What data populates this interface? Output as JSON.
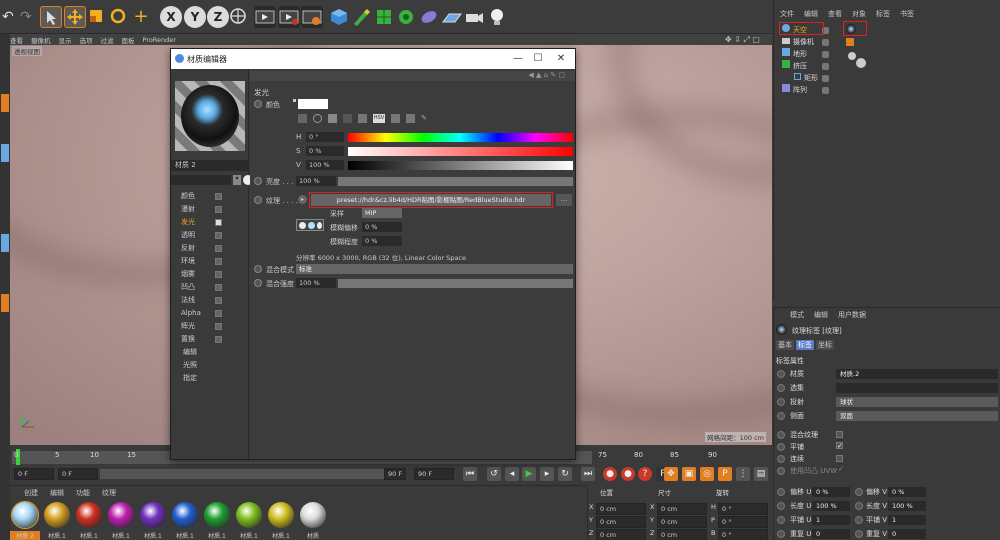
{
  "toolbar": {
    "axis_x": "X",
    "axis_y": "Y",
    "axis_z": "Z"
  },
  "viewport": {
    "menu": [
      "查看",
      "摄像机",
      "显示",
      "选项",
      "过滤",
      "面板",
      "ProRender"
    ],
    "label": "透视视图",
    "grid_spacing": "网格间距：100 cm"
  },
  "timeline": {
    "ticks": [
      "0",
      "5",
      "10",
      "15",
      "75",
      "80",
      "85",
      "90"
    ],
    "start_frame": "0 F",
    "current_frame": "0 F",
    "end_frame": "90 F",
    "end_frame2": "90 F"
  },
  "materials": {
    "menu": [
      "创建",
      "编辑",
      "功能",
      "纹理"
    ],
    "items": [
      {
        "label": "材质 2",
        "color": "#a9d8f5"
      },
      {
        "label": "材质.1",
        "color": "#d4a020"
      },
      {
        "label": "材质.1",
        "color": "#d03020"
      },
      {
        "label": "材质.1",
        "color": "#c020b0"
      },
      {
        "label": "材质.1",
        "color": "#7030c0"
      },
      {
        "label": "材质.1",
        "color": "#2060d0"
      },
      {
        "label": "材质.1",
        "color": "#20a030"
      },
      {
        "label": "材质.1",
        "color": "#80c020"
      },
      {
        "label": "材质.1",
        "color": "#d0c020"
      },
      {
        "label": "材质",
        "color": "#dcdcdc"
      }
    ]
  },
  "coords": {
    "headers": [
      "位置",
      "尺寸",
      "旋转"
    ],
    "rows": [
      {
        "axis": "X",
        "pos": "0 cm",
        "size": "0 cm",
        "rot_axis": "H",
        "rot": "0 °"
      },
      {
        "axis": "Y",
        "pos": "0 cm",
        "size": "0 cm",
        "rot_axis": "P",
        "rot": "0 °"
      },
      {
        "axis": "Z",
        "pos": "0 cm",
        "size": "0 cm",
        "rot_axis": "B",
        "rot": "0 °"
      }
    ]
  },
  "object_manager": {
    "menu": [
      "文件",
      "编辑",
      "查看",
      "对象",
      "标签",
      "书签"
    ],
    "objects": [
      "天空",
      "摄像机",
      "地形",
      "挤压",
      "矩形",
      "阵列"
    ]
  },
  "attribute_manager": {
    "menu": [
      "模式",
      "编辑",
      "用户数据"
    ],
    "title": "纹理标签 [纹理]",
    "tabs": [
      "基本",
      "标签",
      "坐标"
    ],
    "section": "标签属性",
    "material_label": "材质",
    "material_value": "材质.2",
    "selection_label": "选集",
    "projection_label": "投射",
    "projection_value": "球状",
    "side_label": "侧面",
    "side_value": "双面",
    "mix_label": "混合纹理",
    "tile_label": "平铺",
    "seamless_label": "连续",
    "uvw_label": "使用凹凸 UVW",
    "offset_u_label": "偏移 U",
    "offset_u": "0 %",
    "offset_v_label": "偏移 V",
    "offset_v": "0 %",
    "len_u_label": "长度 U",
    "len_u": "100 %",
    "len_v_label": "长度 V",
    "len_v": "100 %",
    "tile_u_label": "平铺 U",
    "tile_u": "1",
    "tile_v_label": "平铺 V",
    "tile_v": "1",
    "rep_u_label": "重复 U",
    "rep_u": "0",
    "rep_v_label": "重复 V",
    "rep_v": "0"
  },
  "dialog": {
    "title": "材质编辑器",
    "material_name": "材质 2",
    "channels": [
      "颜色",
      "漫射",
      "发光",
      "透明",
      "反射",
      "环境",
      "烟雾",
      "凹凸",
      "法线",
      "Alpha",
      "辉光",
      "置换",
      "编辑",
      "光照",
      "指定"
    ],
    "section": "发光",
    "color_label": "颜色",
    "h_label": "H",
    "h_value": "0 °",
    "s_label": "S",
    "s_value": "0 %",
    "v_label": "V",
    "v_value": "100 %",
    "brightness_label": "亮度 . . .",
    "brightness_value": "100 %",
    "texture_label": "纹理 . . . .",
    "texture_path": "preset://hdr&cz.lib4d/HDR贴图/影棚贴图/RedBlueStudio.hdr",
    "browse": "...",
    "sampling_label": "采样",
    "sampling_value": "MIP",
    "blur_offset_label": "模糊偏移",
    "blur_offset_value": "0 %",
    "blur_scale_label": "模糊程度",
    "blur_scale_value": "0 %",
    "resolution": "分辨率 6000 x 3000, RGB (32 位), Linear Color Space",
    "mix_mode_label": "混合模式",
    "mix_mode_value": "标准",
    "mix_strength_label": "混合强度",
    "mix_strength_value": "100 %"
  }
}
